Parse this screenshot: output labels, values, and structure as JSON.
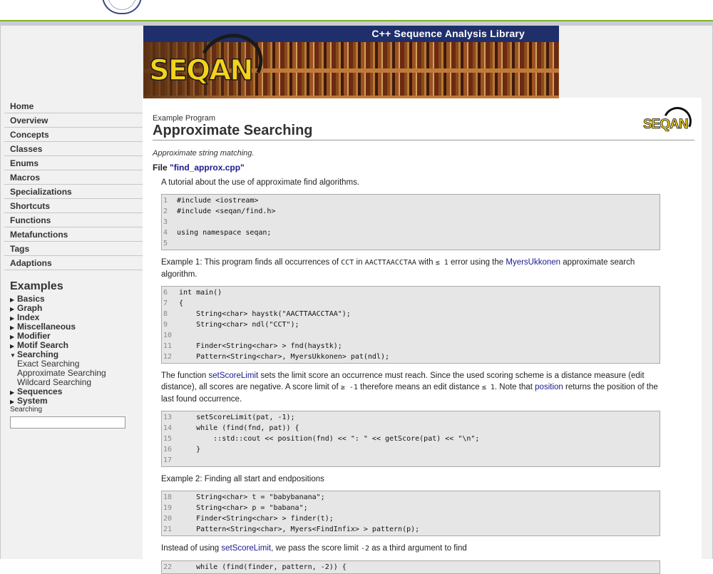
{
  "banner": {
    "tagline": "C++ Sequence Analysis Library",
    "logo": "SEQAN"
  },
  "corner_logo": "SEQAN",
  "sidebar": {
    "nav": [
      "Home",
      "Overview",
      "Concepts",
      "Classes",
      "Enums",
      "Macros",
      "Specializations",
      "Shortcuts",
      "Functions",
      "Metafunctions",
      "Tags",
      "Adaptions"
    ],
    "examples_heading": "Examples",
    "examples": [
      {
        "label": "Basics",
        "expanded": false
      },
      {
        "label": "Graph",
        "expanded": false
      },
      {
        "label": "Index",
        "expanded": false
      },
      {
        "label": "Miscellaneous",
        "expanded": false
      },
      {
        "label": "Modifier",
        "expanded": false
      },
      {
        "label": "Motif Search",
        "expanded": false
      },
      {
        "label": "Searching",
        "expanded": true
      },
      {
        "label": "Sequences",
        "expanded": false
      },
      {
        "label": "System",
        "expanded": false
      }
    ],
    "searching_children": [
      "Exact Searching",
      "Approximate Searching",
      "Wildcard Searching"
    ],
    "search_label": "Searching",
    "search_value": ""
  },
  "main": {
    "kicker": "Example Program",
    "title": "Approximate Searching",
    "subtitle": "Approximate string matching.",
    "file_prefix": "File",
    "file_link": "\"find_approx.cpp\"",
    "intro": "A tutorial about the use of approximate find algorithms.",
    "code1": [
      {
        "n": "1",
        "t": "#include <iostream>"
      },
      {
        "n": "2",
        "t": "#include <seqan/find.h>"
      },
      {
        "n": "3",
        "t": ""
      },
      {
        "n": "4",
        "t": "using namespace seqan;"
      },
      {
        "n": "5",
        "t": ""
      }
    ],
    "ex1": {
      "a": "Example 1: This program finds all occurrences of ",
      "c1": "CCT",
      "b": " in ",
      "c2": "AACTTAACCTAA",
      "c": " with ",
      "c3": "≤ 1",
      "d": " error using the ",
      "link": "MyersUkkonen",
      "e": " approximate search algorithm."
    },
    "code2": [
      {
        "n": "6",
        "t": "int main()"
      },
      {
        "n": "7",
        "t": "{"
      },
      {
        "n": "8",
        "t": "    String<char> haystk(\"AACTTAACCTAA\");"
      },
      {
        "n": "9",
        "t": "    String<char> ndl(\"CCT\");"
      },
      {
        "n": "10",
        "t": ""
      },
      {
        "n": "11",
        "t": "    Finder<String<char> > fnd(haystk);"
      },
      {
        "n": "12",
        "t": "    Pattern<String<char>, MyersUkkonen> pat(ndl);"
      }
    ],
    "p2": {
      "a": "The function ",
      "link1": "setScoreLimit",
      "b": " sets the limit score an occurrence must reach. Since the used scoring scheme is a distance measure (edit distance), all scores are negative. A score limit of ",
      "c1": "≥ -1",
      "c": " therefore means an edit distance ",
      "c2": "≤ 1",
      "d": ". Note that ",
      "link2": "position",
      "e": " returns the position of the last found occurrence."
    },
    "code3": [
      {
        "n": "13",
        "t": "    setScoreLimit(pat, -1);"
      },
      {
        "n": "14",
        "t": "    while (find(fnd, pat)) {"
      },
      {
        "n": "15",
        "t": "        ::std::cout << position(fnd) << \": \" << getScore(pat) << \"\\n\";"
      },
      {
        "n": "16",
        "t": "    }"
      },
      {
        "n": "17",
        "t": ""
      }
    ],
    "ex2": "Example 2: Finding all start and endpositions",
    "code4": [
      {
        "n": "18",
        "t": "    String<char> t = \"babybanana\";"
      },
      {
        "n": "19",
        "t": "    String<char> p = \"babana\";"
      },
      {
        "n": "20",
        "t": "    Finder<String<char> > finder(t);"
      },
      {
        "n": "21",
        "t": "    Pattern<String<char>, Myers<FindInfix> > pattern(p);"
      }
    ],
    "p3": {
      "a": "Instead of using ",
      "link": "setScoreLimit",
      "b": ", we pass the score limit ",
      "c": "-2",
      "d": " as a third argument to find"
    },
    "code5": [
      {
        "n": "22",
        "t": "    while (find(finder, pattern, -2)) {"
      }
    ]
  }
}
